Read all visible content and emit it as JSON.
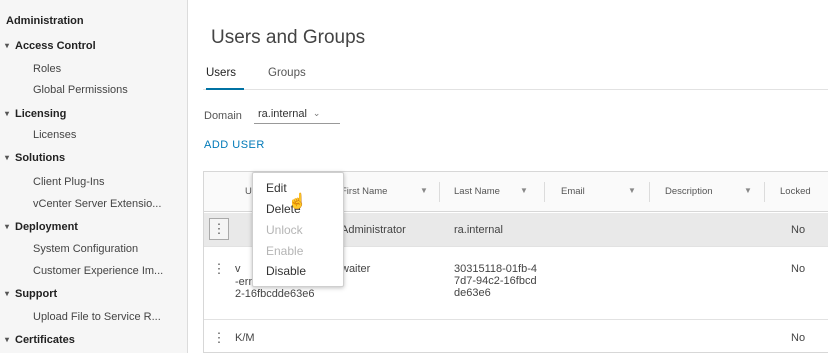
{
  "sidebar": {
    "header": "Administration",
    "sections": [
      {
        "label": "Access Control",
        "items": [
          "Roles",
          "Global Permissions"
        ]
      },
      {
        "label": "Licensing",
        "items": [
          "Licenses"
        ]
      },
      {
        "label": "Solutions",
        "items": [
          "Client Plug-Ins",
          "vCenter Server Extensio..."
        ]
      },
      {
        "label": "Deployment",
        "items": [
          "System Configuration",
          "Customer Experience Im..."
        ]
      },
      {
        "label": "Support",
        "items": [
          "Upload File to Service R..."
        ]
      },
      {
        "label": "Certificates",
        "items": []
      }
    ],
    "caret_icon": "caret-down-icon"
  },
  "main": {
    "title": "Users and Groups",
    "tabs": [
      {
        "label": "Users",
        "active": true
      },
      {
        "label": "Groups",
        "active": false
      }
    ],
    "domain": {
      "label": "Domain",
      "value": "ra.internal"
    },
    "add_user_label": "ADD USER",
    "table": {
      "columns": [
        "U",
        "First Name",
        "Last Name",
        "Email",
        "Description",
        "Locked"
      ],
      "rows": [
        {
          "username": "",
          "first_name": "Administrator",
          "last_name": "ra.internal",
          "locked": "No",
          "selected": true
        },
        {
          "username_prefix": "v",
          "username_visible": "-ern  47d7-94c\n2-16fbcdde63e6",
          "first_name": "waiter",
          "last_name": "30315118-01fb-4\n7d7-94c2-16fbcd\nde63e6",
          "locked": "No",
          "selected": false
        },
        {
          "username": "K/M",
          "first_name": "",
          "last_name": "",
          "locked": "No",
          "selected": false
        }
      ]
    }
  },
  "context_menu": {
    "items": [
      {
        "label": "Edit",
        "enabled": true
      },
      {
        "label": "Delete",
        "enabled": true
      },
      {
        "label": "Unlock",
        "enabled": false
      },
      {
        "label": "Enable",
        "enabled": false
      },
      {
        "label": "Disable",
        "enabled": true
      }
    ]
  },
  "colors": {
    "accent": "#0072a3",
    "link": "#0079b8",
    "selected_row": "#e9e9e9",
    "sidebar_bg": "#f6f6f6"
  }
}
